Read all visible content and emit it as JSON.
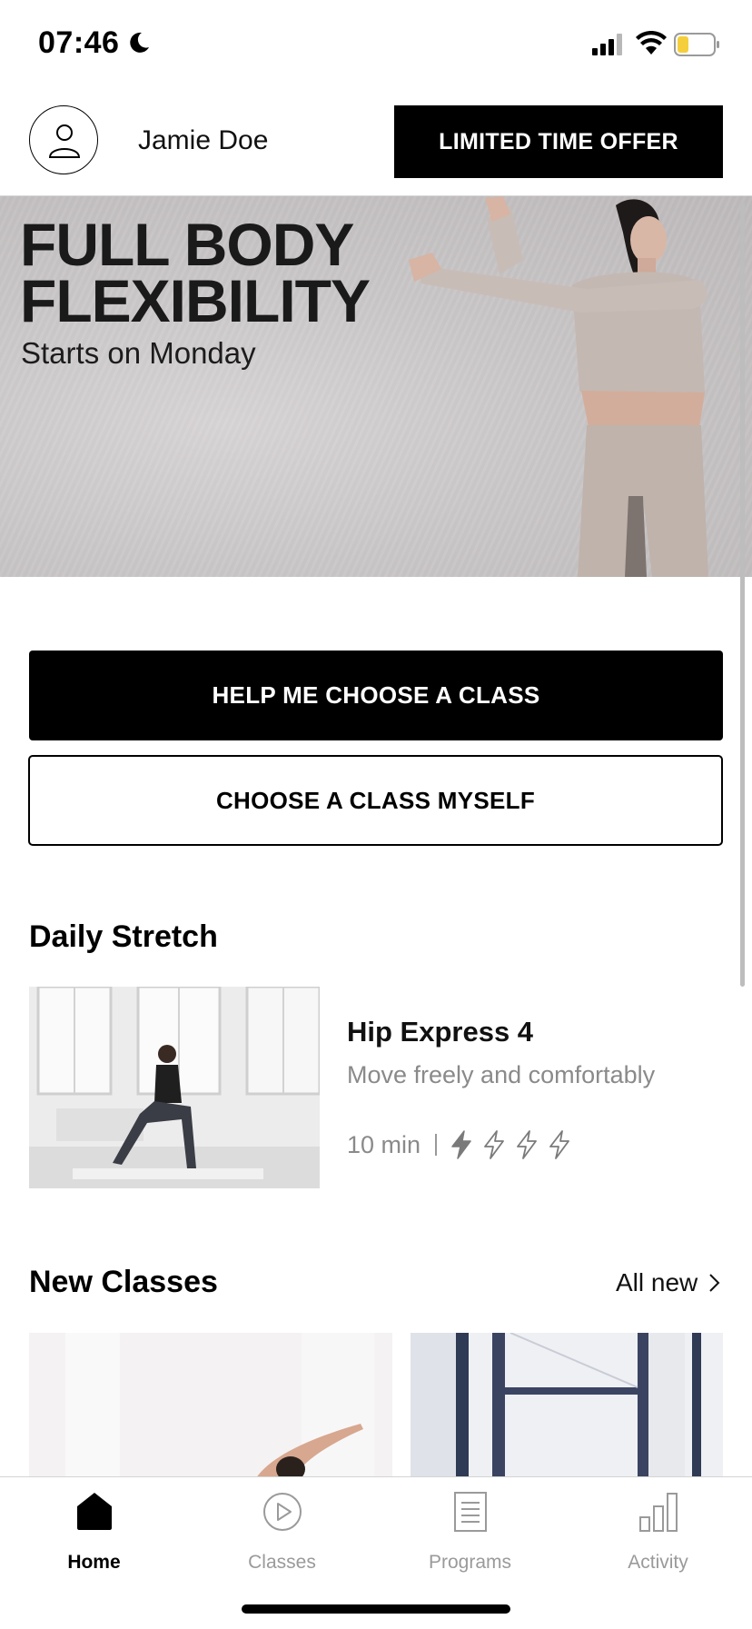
{
  "status_bar": {
    "time": "07:46"
  },
  "header": {
    "user_name": "Jamie Doe",
    "offer_label": "LIMITED TIME OFFER"
  },
  "hero": {
    "title_line1": "FULL BODY",
    "title_line2": "FLEXIBILITY",
    "subtitle": "Starts on Monday"
  },
  "actions": {
    "help_label": "HELP ME CHOOSE A CLASS",
    "self_label": "CHOOSE A CLASS MYSELF"
  },
  "daily_stretch": {
    "section_title": "Daily Stretch",
    "class_name": "Hip Express 4",
    "description": "Move freely and comfortably",
    "duration": "10 min",
    "intensity_level": 1,
    "intensity_max": 4
  },
  "new_classes": {
    "section_title": "New Classes",
    "all_new_label": "All new"
  },
  "tabs": [
    {
      "label": "Home",
      "icon": "home-icon",
      "active": true
    },
    {
      "label": "Classes",
      "icon": "play-circle-icon",
      "active": false
    },
    {
      "label": "Programs",
      "icon": "list-icon",
      "active": false
    },
    {
      "label": "Activity",
      "icon": "bar-chart-icon",
      "active": false
    }
  ],
  "colors": {
    "primary": "#000000",
    "muted_text": "#8a8a8a",
    "battery_fill": "#f5cf3b"
  }
}
